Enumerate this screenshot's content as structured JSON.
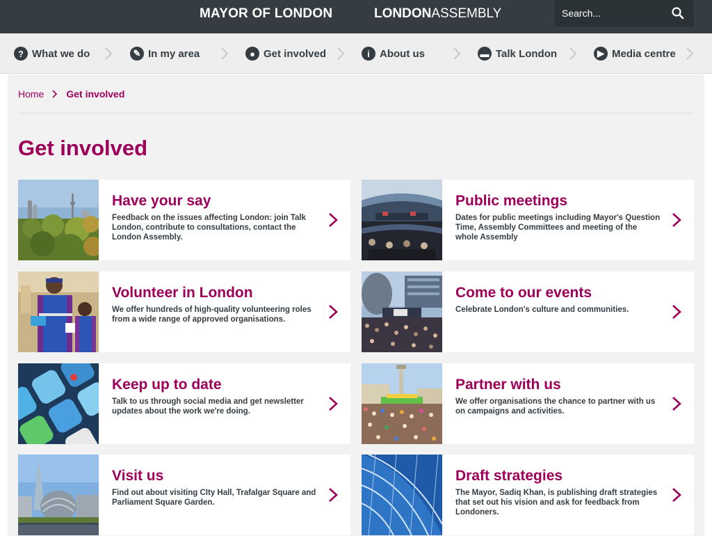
{
  "header": {
    "mayor_brand": "MAYOR OF LONDON",
    "assembly_brand_bold": "LONDON",
    "assembly_brand_light": "ASSEMBLY",
    "search_placeholder": "Search..."
  },
  "nav": [
    {
      "label": "What we do",
      "icon": "?"
    },
    {
      "label": "In my area",
      "icon": "✎"
    },
    {
      "label": "Get involved",
      "icon": "●"
    },
    {
      "label": "About us",
      "icon": "i"
    },
    {
      "label": "Talk London",
      "icon": "▬"
    },
    {
      "label": "Media centre",
      "icon": "▶"
    }
  ],
  "breadcrumb": {
    "home": "Home",
    "current": "Get involved"
  },
  "page_title": "Get involved",
  "cards": [
    {
      "title": "Have your say",
      "desc": "Feedback on the issues affecting London: join Talk London, contribute to consultations, contact the London Assembly."
    },
    {
      "title": "Public meetings",
      "desc": "Dates for public meetings including Mayor's Question Time, Assembly Committees and meeting of the whole Assembly"
    },
    {
      "title": "Volunteer in London",
      "desc": "We offer hundreds of high-quality volunteering roles from a wide range of approved organisations."
    },
    {
      "title": "Come to our events",
      "desc": "Celebrate London's culture and communities."
    },
    {
      "title": "Keep up to date",
      "desc": "Talk to us through social media and get newsletter updates about the work we're doing."
    },
    {
      "title": "Partner with us",
      "desc": "We offer organisations the chance to partner with us on campaigns and activities."
    },
    {
      "title": "Visit us",
      "desc": "Find out about visiting CIty Hall, Trafalgar Square and Parliament Square Garden."
    },
    {
      "title": "Draft strategies",
      "desc": "The Mayor, Sadiq Khan, is publishing draft strategies that set out his vision and ask for feedback from Londoners."
    }
  ],
  "colors": {
    "brand": "#9e0059",
    "header_bg": "#353d42",
    "nav_bg": "#eeeeee",
    "content_bg": "#f2f2f2"
  }
}
